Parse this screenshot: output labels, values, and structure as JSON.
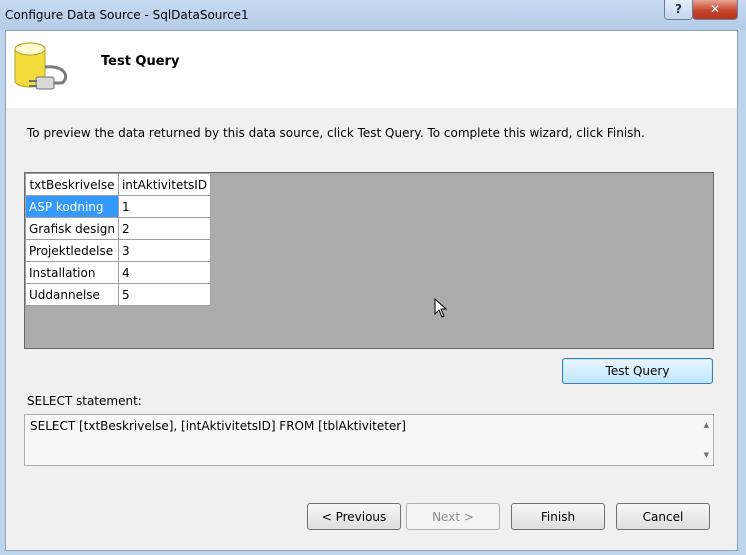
{
  "window": {
    "title": "Configure Data Source - SqlDataSource1",
    "help_label": "?",
    "close_label": "✕"
  },
  "header": {
    "icon": "database-plug-icon",
    "title": "Test Query"
  },
  "instruction": "To preview the data returned by this data source, click Test Query. To complete this wizard, click Finish.",
  "grid": {
    "columns": [
      "txtBeskrivelse",
      "intAktivitetsID"
    ],
    "rows": [
      [
        "ASP kodning",
        "1"
      ],
      [
        "Grafisk design",
        "2"
      ],
      [
        "Projektledelse",
        "3"
      ],
      [
        "Installation",
        "4"
      ],
      [
        "Uddannelse",
        "5"
      ]
    ],
    "selected_row": 0
  },
  "buttons": {
    "test_query": "Test Query",
    "previous": "< Previous",
    "next": "Next >",
    "finish": "Finish",
    "cancel": "Cancel"
  },
  "select_statement": {
    "label": "SELECT statement:",
    "text": "SELECT [txtBeskrivelse], [intAktivitetsID] FROM [tblAktiviteter]"
  },
  "colors": {
    "selection": "#3399ff",
    "grid_background": "#ababab"
  }
}
